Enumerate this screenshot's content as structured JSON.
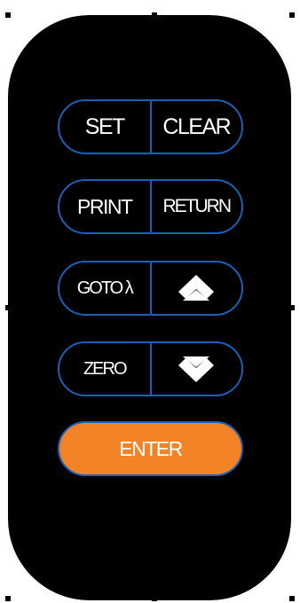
{
  "colors": {
    "panel": "#000000",
    "button_border": "#1b5fb8",
    "button_text": "#ffffff",
    "enter_fill": "#f28427"
  },
  "keypad": {
    "rows": [
      {
        "left_label": "SET",
        "right_label": "CLEAR"
      },
      {
        "left_label": "PRINT",
        "right_label": "RETURN"
      },
      {
        "left_label": "GOTO λ",
        "right_icon": "up-arrow-icon"
      },
      {
        "left_label": "ZERO",
        "right_icon": "down-arrow-icon"
      }
    ],
    "enter_label": "ENTER"
  }
}
